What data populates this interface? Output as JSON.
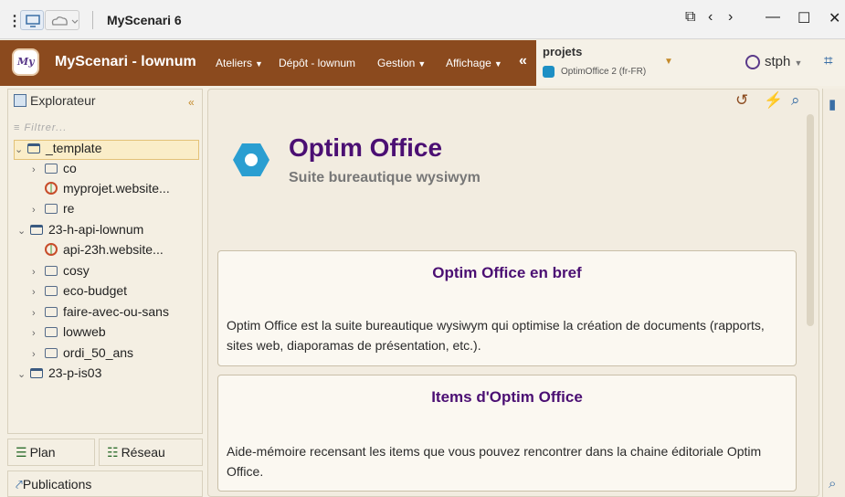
{
  "titlebar": {
    "menu_icon": "⋮",
    "monitor_icon": "monitor-icon",
    "cloud_icon": "cloud-icon",
    "title": "MyScenari 6",
    "window_controls": [
      "⧉",
      "‹",
      "›",
      "—",
      "☐",
      "✕"
    ]
  },
  "header": {
    "logo_text": "My",
    "app_title": "MyScenari - lownum",
    "menus": [
      "Ateliers",
      "Dépôt - lownum",
      "Gestion",
      "Affichage"
    ],
    "collapse": "«",
    "project": {
      "label": "projets",
      "selected": "OptimOffice 2 (fr-FR)"
    },
    "user": "stph"
  },
  "sidebar": {
    "title": "Explorateur",
    "collapse": "«",
    "filter_placeholder": "Filtrer...",
    "tree": [
      {
        "label": "_template",
        "kind": "workspace",
        "expanded": true,
        "selected": true,
        "indent": 0
      },
      {
        "label": "co",
        "kind": "folder",
        "expanded": false,
        "indent": 1
      },
      {
        "label": "myprojet.website...",
        "kind": "web",
        "indent": 1
      },
      {
        "label": "re",
        "kind": "folder",
        "expanded": false,
        "indent": 1
      },
      {
        "label": "23-h-api-lownum",
        "kind": "workspace",
        "expanded": true,
        "indent": 0
      },
      {
        "label": "api-23h.website...",
        "kind": "web",
        "indent": 1
      },
      {
        "label": "cosy",
        "kind": "folder",
        "expanded": false,
        "indent": 1
      },
      {
        "label": "eco-budget",
        "kind": "folder",
        "expanded": false,
        "indent": 1
      },
      {
        "label": "faire-avec-ou-sans",
        "kind": "folder",
        "expanded": false,
        "indent": 1
      },
      {
        "label": "lowweb",
        "kind": "folder",
        "expanded": false,
        "indent": 1
      },
      {
        "label": "ordi_50_ans",
        "kind": "folder",
        "expanded": false,
        "indent": 1
      },
      {
        "label": "23-p-is03",
        "kind": "workspace",
        "expanded": true,
        "indent": 0
      }
    ],
    "tabs": {
      "plan": "Plan",
      "reseau": "Réseau"
    },
    "publications": "Publications"
  },
  "document": {
    "title": "Optim Office",
    "subtitle": "Suite bureautique wysiwym",
    "cards": [
      {
        "title": "Optim Office en bref",
        "body": "Optim Office est la suite bureautique wysiwym qui optimise la création de documents (rapports, sites web, diaporamas de présentation, etc.)."
      },
      {
        "title": "Items d'Optim Office",
        "body": "Aide-mémoire recensant les items que vous pouvez rencontrer dans la chaine éditoriale Optim Office."
      }
    ]
  },
  "colors": {
    "header_brown": "#8b4a1e",
    "title_purple": "#4b0f73",
    "logo_blue": "#2a9ed1"
  }
}
